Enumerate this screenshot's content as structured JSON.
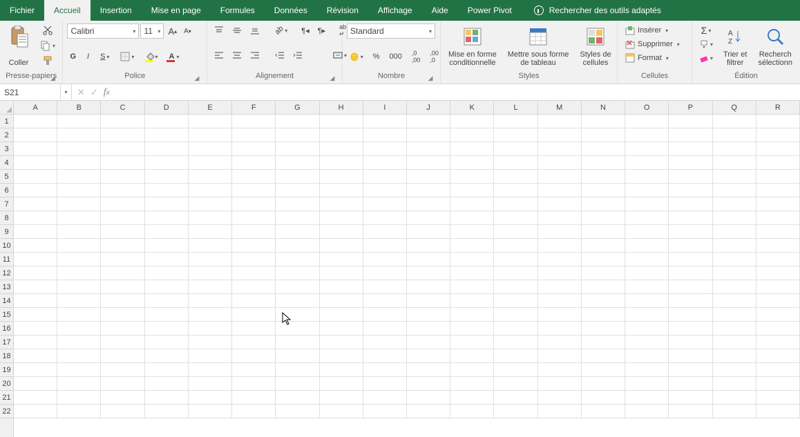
{
  "tabs": [
    "Fichier",
    "Accueil",
    "Insertion",
    "Mise en page",
    "Formules",
    "Données",
    "Révision",
    "Affichage",
    "Aide",
    "Power Pivot"
  ],
  "active_tab": 1,
  "tell_me": "Rechercher des outils adaptés",
  "clipboard": {
    "paste": "Coller",
    "label": "Presse-papiers"
  },
  "font": {
    "name": "Calibri",
    "size": "11",
    "label": "Police"
  },
  "alignment": {
    "label": "Alignement"
  },
  "number": {
    "format": "Standard",
    "label": "Nombre"
  },
  "styles": {
    "cf": "Mise en forme\nconditionnelle",
    "table": "Mettre sous forme\nde tableau",
    "cell": "Styles de\ncellules",
    "label": "Styles"
  },
  "cells": {
    "insert": "Insérer",
    "delete": "Supprimer",
    "format": "Format",
    "label": "Cellules"
  },
  "editing": {
    "sort": "Trier et\nfiltrer",
    "find": "Recherch\nsélectionn",
    "label": "Édition"
  },
  "name_box": "S21",
  "columns": [
    "A",
    "B",
    "C",
    "D",
    "E",
    "F",
    "G",
    "H",
    "I",
    "J",
    "K",
    "L",
    "M",
    "N",
    "O",
    "P",
    "Q",
    "R"
  ],
  "rows": 22
}
